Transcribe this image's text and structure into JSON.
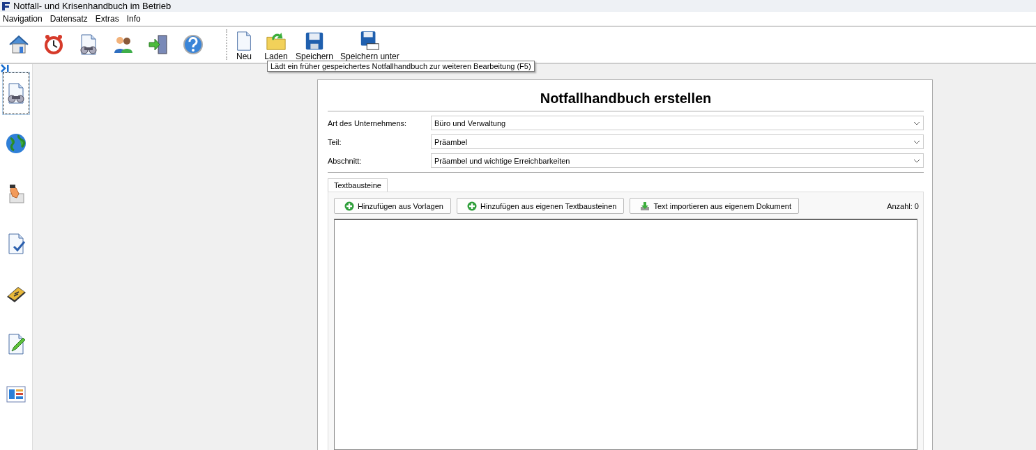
{
  "window": {
    "title": "Notfall- und Krisenhandbuch im Betrieb"
  },
  "menu": [
    "Navigation",
    "Datensatz",
    "Extras",
    "Info"
  ],
  "toolbar": {
    "icon_buttons": [
      {
        "kind": "home"
      },
      {
        "kind": "alarm"
      },
      {
        "kind": "binoculars"
      },
      {
        "kind": "users"
      },
      {
        "kind": "exit"
      },
      {
        "kind": "help"
      }
    ],
    "file_buttons": [
      {
        "kind": "new",
        "label": "Neu"
      },
      {
        "kind": "open",
        "label": "Laden"
      },
      {
        "kind": "save",
        "label": "Speichern"
      },
      {
        "kind": "saveas",
        "label": "Speichern unter"
      }
    ]
  },
  "tooltip": "Lädt ein früher gespeichertes Notfallhandbuch zur weiteren Bearbeitung (F5)",
  "sidebar": {
    "items": [
      {
        "kind": "binoculars",
        "selected": true
      },
      {
        "kind": "globe",
        "selected": false
      },
      {
        "kind": "hand",
        "selected": false
      },
      {
        "kind": "check",
        "selected": false
      },
      {
        "kind": "book",
        "selected": false
      },
      {
        "kind": "edit",
        "selected": false
      },
      {
        "kind": "grid",
        "selected": false
      }
    ]
  },
  "form": {
    "title": "Notfallhandbuch erstellen",
    "fields": [
      {
        "label": "Art des Unternehmens:",
        "value": "Büro und Verwaltung"
      },
      {
        "label": "Teil:",
        "value": "Präambel"
      },
      {
        "label": "Abschnitt:",
        "value": "Präambel und wichtige Erreichbarkeiten"
      }
    ],
    "tabs": [
      {
        "label": "Textbausteine",
        "selected": true
      }
    ],
    "buttons": [
      {
        "kind": "add",
        "label": "Hinzufügen aus Vorlagen"
      },
      {
        "kind": "add",
        "label": "Hinzufügen aus eigenen Textbausteinen"
      },
      {
        "kind": "import",
        "label": "Text importieren aus eigenem Dokument"
      }
    ],
    "count": "Anzahl: 0"
  }
}
